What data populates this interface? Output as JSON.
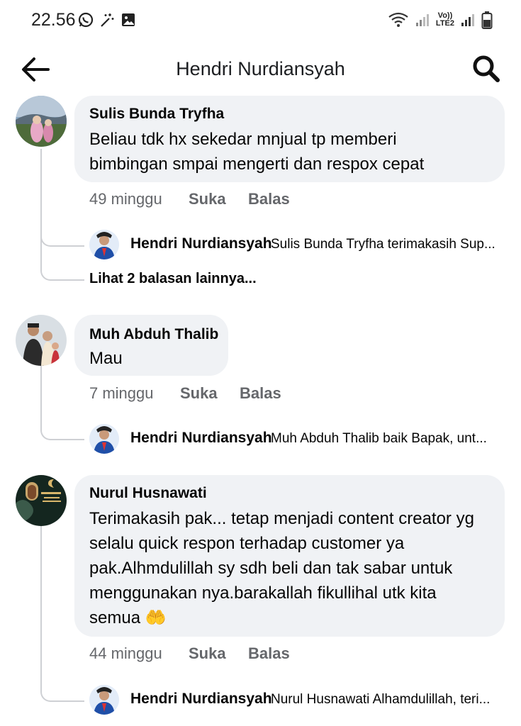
{
  "status_bar": {
    "time": "22.56",
    "left_icons": [
      "whatsapp-icon",
      "magic-wand-icon",
      "image-icon"
    ],
    "right_icons": [
      "wifi-icon",
      "signal-icon",
      "volte-icon",
      "signal-icon-2",
      "battery-icon"
    ],
    "volte_line1": "Vo))",
    "volte_line2": "LTE2"
  },
  "header": {
    "title": "Hendri Nurdiansyah",
    "back_icon": "arrow-left-icon",
    "search_icon": "search-icon"
  },
  "comments": [
    {
      "author": "Sulis Bunda Tryfha",
      "text_lines": [
        "Beliau tdk hx sekedar mnjual tp memberi",
        "bimbingan smpai mengerti dan respox cepat"
      ],
      "time": "49 minggu",
      "like_label": "Suka",
      "reply_label": "Balas",
      "reply": {
        "author": "Hendri Nurdiansyah",
        "text": "Sulis Bunda Tryfha terimakasih Sup..."
      },
      "more_replies": "Lihat 2 balasan lainnya..."
    },
    {
      "author": "Muh Abduh Thalib",
      "text_lines": [
        "Mau"
      ],
      "time": "7 minggu",
      "like_label": "Suka",
      "reply_label": "Balas",
      "reply": {
        "author": "Hendri Nurdiansyah",
        "text": "Muh Abduh Thalib baik Bapak, unt..."
      }
    },
    {
      "author": "Nurul Husnawati",
      "text_lines": [
        "Terimakasih pak... tetap menjadi content creator yg",
        "selalu quick respon terhadap customer ya",
        "pak.Alhmdulillah sy sdh beli dan tak sabar untuk",
        "menggunakan nya.barakallah fikullihal utk kita",
        "semua"
      ],
      "emoji": "🤲",
      "time": "44 minggu",
      "like_label": "Suka",
      "reply_label": "Balas",
      "reply": {
        "author": "Hendri Nurdiansyah",
        "text": "Nurul Husnawati Alhamdulillah, teri..."
      }
    }
  ],
  "colors": {
    "bubble": "#f0f2f5",
    "meta_text": "#65676b",
    "thread_line": "#ced0d4"
  }
}
